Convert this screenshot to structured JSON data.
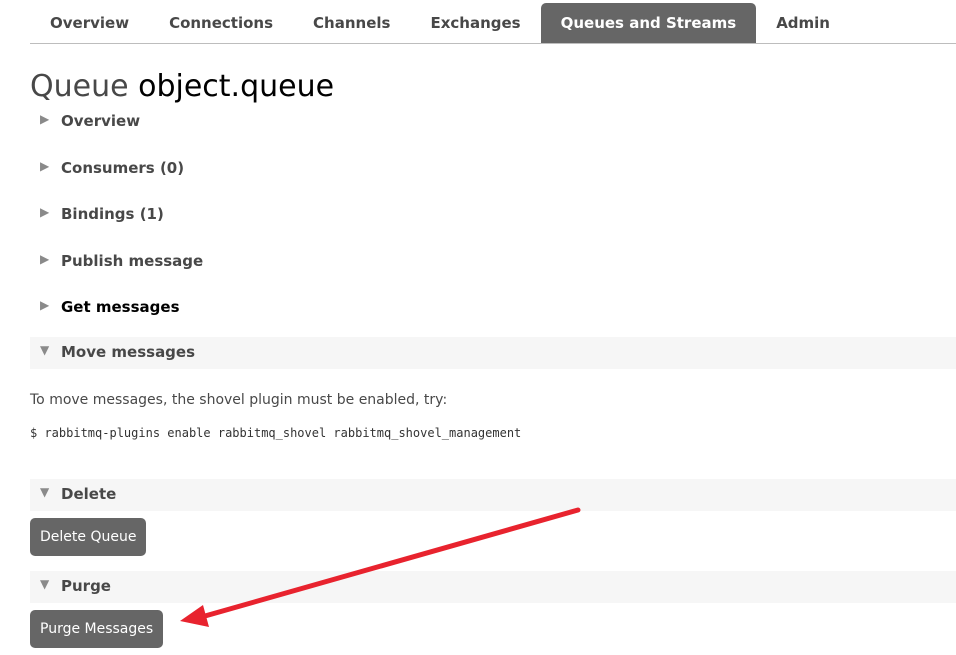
{
  "nav": {
    "tabs": [
      {
        "label": "Overview"
      },
      {
        "label": "Connections"
      },
      {
        "label": "Channels"
      },
      {
        "label": "Exchanges"
      },
      {
        "label": "Queues and Streams",
        "active": true
      },
      {
        "label": "Admin"
      }
    ]
  },
  "page": {
    "title_prefix": "Queue",
    "title_name": "object.queue"
  },
  "sections": {
    "overview": "Overview",
    "consumers": "Consumers (0)",
    "bindings": "Bindings (1)",
    "publish": "Publish message",
    "get": "Get messages",
    "move": "Move messages",
    "delete": "Delete",
    "purge": "Purge"
  },
  "move": {
    "hint": "To move messages, the shovel plugin must be enabled, try:",
    "command": "$ rabbitmq-plugins enable rabbitmq_shovel rabbitmq_shovel_management"
  },
  "buttons": {
    "delete_queue": "Delete Queue",
    "purge_messages": "Purge Messages"
  },
  "icons": {
    "collapsed": "triangle-right-icon",
    "expanded": "triangle-down-icon"
  },
  "colors": {
    "active_tab": "#666666",
    "annotation_arrow": "#e8232e"
  }
}
